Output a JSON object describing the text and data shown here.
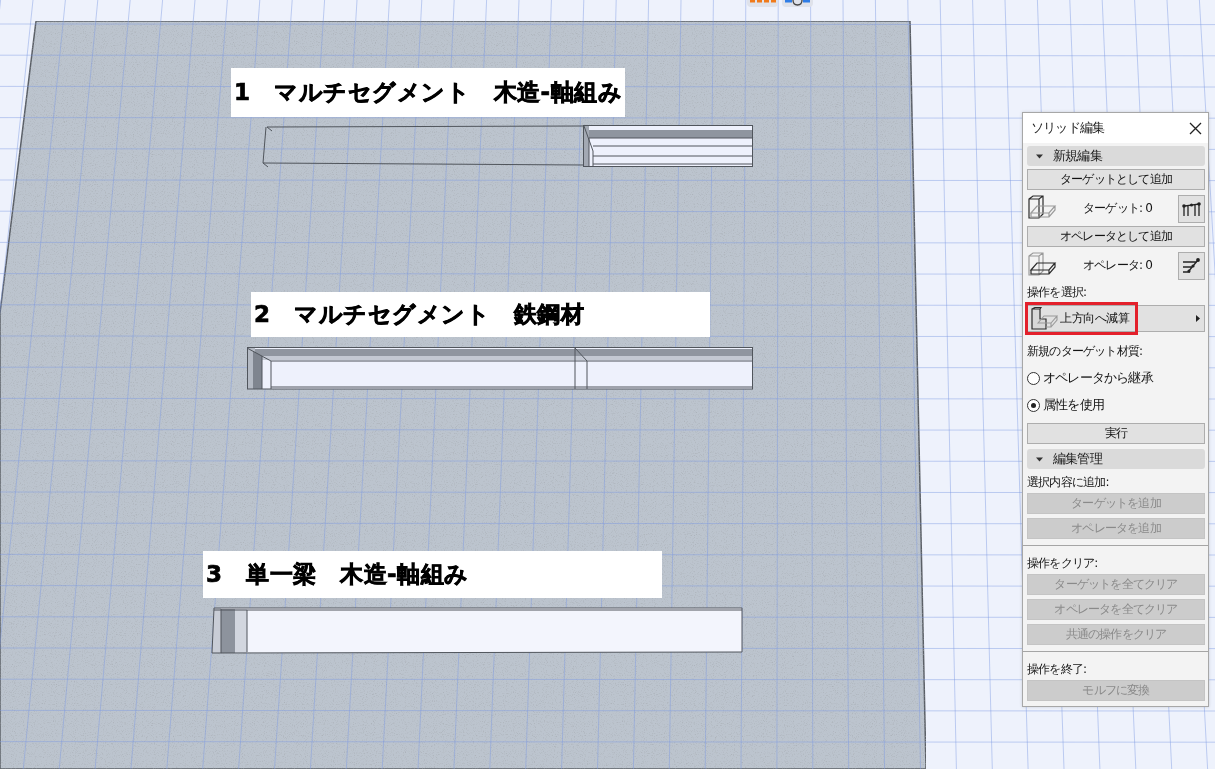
{
  "viewport": {
    "labels": [
      "1　マルチセグメント　木造-軸組み",
      "2　マルチセグメント　鉄鋼材",
      "3　単一梁　木造-軸組み"
    ]
  },
  "panel": {
    "title": "ソリッド編集",
    "sections": [
      {
        "title": "新規編集",
        "expanded": true,
        "items": [
          {
            "kind": "button",
            "label": "ターゲットとして追加",
            "disabled": false
          },
          {
            "kind": "target",
            "label": "ターゲット: 0"
          },
          {
            "kind": "button",
            "label": "オペレータとして追加",
            "disabled": false
          },
          {
            "kind": "operator",
            "label": "オペレータ: 0"
          },
          {
            "kind": "caption",
            "label": "操作を選択:"
          },
          {
            "kind": "select",
            "value": "上方向へ減算",
            "highlighted": true
          },
          {
            "kind": "caption",
            "label": "新規のターゲット材質:"
          },
          {
            "kind": "radio",
            "label": "オペレータから継承",
            "selected": false
          },
          {
            "kind": "radio",
            "label": "属性を使用",
            "selected": true
          },
          {
            "kind": "button",
            "label": "実行",
            "disabled": false
          }
        ]
      },
      {
        "title": "編集管理",
        "expanded": true,
        "items": [
          {
            "kind": "caption",
            "label": "選択内容に追加:"
          },
          {
            "kind": "button",
            "label": "ターゲットを追加",
            "disabled": true
          },
          {
            "kind": "button",
            "label": "オペレータを追加",
            "disabled": true
          },
          {
            "kind": "divider"
          },
          {
            "kind": "caption",
            "label": "操作をクリア:"
          },
          {
            "kind": "button",
            "label": "ターゲットを全てクリア",
            "disabled": true
          },
          {
            "kind": "button",
            "label": "オペレータを全てクリア",
            "disabled": true
          },
          {
            "kind": "button",
            "label": "共通の操作をクリア",
            "disabled": true
          },
          {
            "kind": "divider"
          },
          {
            "kind": "caption",
            "label": "操作を終了:"
          },
          {
            "kind": "button",
            "label": "モルフに変換",
            "disabled": true
          }
        ]
      }
    ]
  }
}
